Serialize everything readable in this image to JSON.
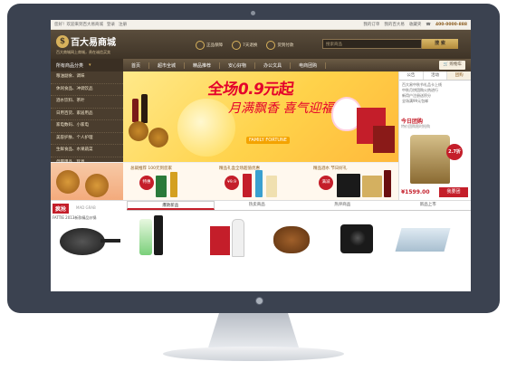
{
  "topbar": {
    "left": [
      "您好！欢迎来到百大易商城",
      "登录",
      "注册"
    ],
    "right": [
      "我的订单",
      "我的百大易",
      "收藏夹"
    ],
    "phone": "400-0000-888"
  },
  "header": {
    "logo_mark": "$",
    "logo_name": "百大易商城",
    "slogan": "百大商城网上商城，贵在诚信买卖",
    "features": [
      "正品保障",
      "7天退换",
      "货到付款"
    ],
    "search_placeholder": "搜索商品",
    "search_button": "搜 索"
  },
  "nav": {
    "all_categories": "所有商品分类",
    "links": [
      "首页",
      "超市全城",
      "精品推荐",
      "安心好物",
      "办公文具",
      "电商团购"
    ],
    "cart": "购物车"
  },
  "sidebar": {
    "items": [
      "粮油副食、调味",
      "休闲食品、冲调饮品",
      "酒水饮料、茶叶",
      "日用百货、家居用品",
      "家电数码、小家电",
      "美容护肤、个人护理",
      "生鲜食品、水果蔬菜",
      "母婴用品、玩具"
    ]
  },
  "banner": {
    "headline": "全场0.9元起",
    "calligraphy": "月满飘香 喜气迎福",
    "english": "FAMILY FORTUNE"
  },
  "promo": {
    "text1": "总裁推荐 100元到您家",
    "text2": "精品礼盒全场超值优惠",
    "text3": "精品酒水 节日好礼",
    "tag1": "特惠",
    "tag2": "¥9.9",
    "tag3": "满减"
  },
  "rpanel": {
    "tabs": [
      "公告",
      "活动",
      "团购"
    ],
    "list": [
      "百大易中秋节礼品卡上线",
      "中秋月饼团购火热进行",
      "新用户注册送积分",
      "全场满99元包邮"
    ],
    "today": "今日团购",
    "today_sub": "特价团购限时抢购",
    "discount": "2.7折",
    "price": "¥1599.00",
    "buy": "我要团"
  },
  "flash": {
    "tag": "疯抢",
    "en": "MAD GRAB",
    "desc": "FATTIE 2013新款精品炒锅"
  },
  "bottom_tabs": [
    "爆款新品",
    "热卖商品",
    "热评商品",
    "新品上市"
  ]
}
